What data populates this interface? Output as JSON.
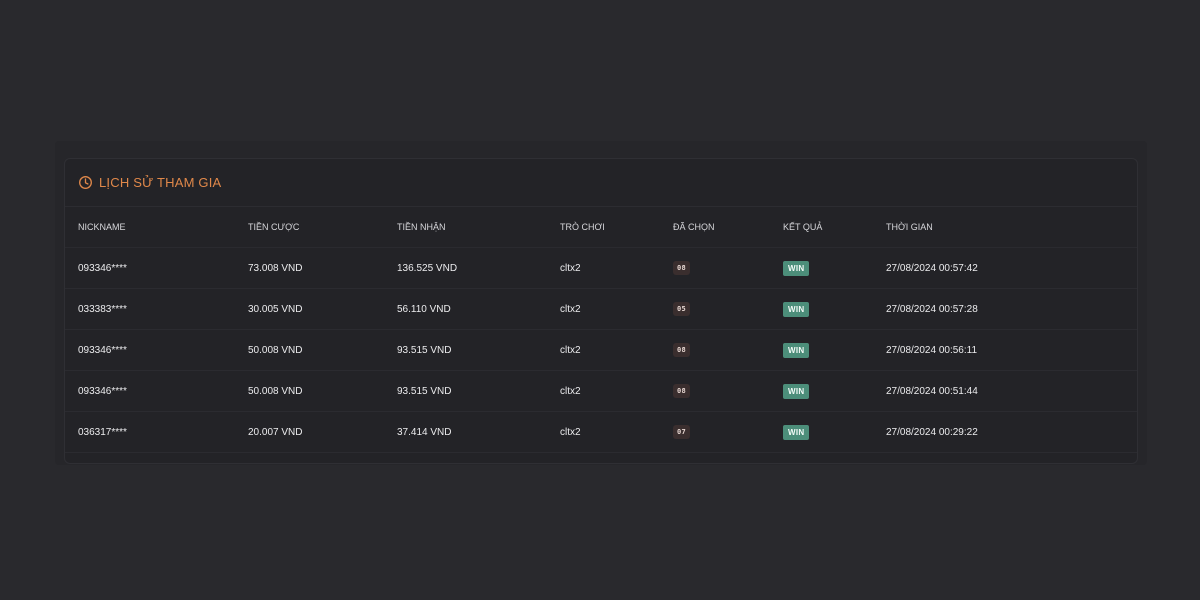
{
  "panel": {
    "title": "LỊCH SỬ THAM GIA",
    "icon": "clock-icon",
    "accent_color": "#e0884a"
  },
  "table": {
    "headers": [
      "NICKNAME",
      "TIỀN CƯỢC",
      "TIỀN NHẬN",
      "TRÒ CHƠI",
      "ĐÃ CHỌN",
      "KẾT QUẢ",
      "THỜI GIAN"
    ],
    "rows": [
      {
        "nickname": "093346****",
        "bet": "73.008 VND",
        "received": "136.525 VND",
        "game": "cltx2",
        "picked": "08",
        "result": "WIN",
        "time": "27/08/2024 00:57:42"
      },
      {
        "nickname": "033383****",
        "bet": "30.005 VND",
        "received": "56.110 VND",
        "game": "cltx2",
        "picked": "05",
        "result": "WIN",
        "time": "27/08/2024 00:57:28"
      },
      {
        "nickname": "093346****",
        "bet": "50.008 VND",
        "received": "93.515 VND",
        "game": "cltx2",
        "picked": "08",
        "result": "WIN",
        "time": "27/08/2024 00:56:11"
      },
      {
        "nickname": "093346****",
        "bet": "50.008 VND",
        "received": "93.515 VND",
        "game": "cltx2",
        "picked": "08",
        "result": "WIN",
        "time": "27/08/2024 00:51:44"
      },
      {
        "nickname": "036317****",
        "bet": "20.007 VND",
        "received": "37.414 VND",
        "game": "cltx2",
        "picked": "07",
        "result": "WIN",
        "time": "27/08/2024 00:29:22"
      }
    ],
    "win_color": "#4c8e7a"
  }
}
